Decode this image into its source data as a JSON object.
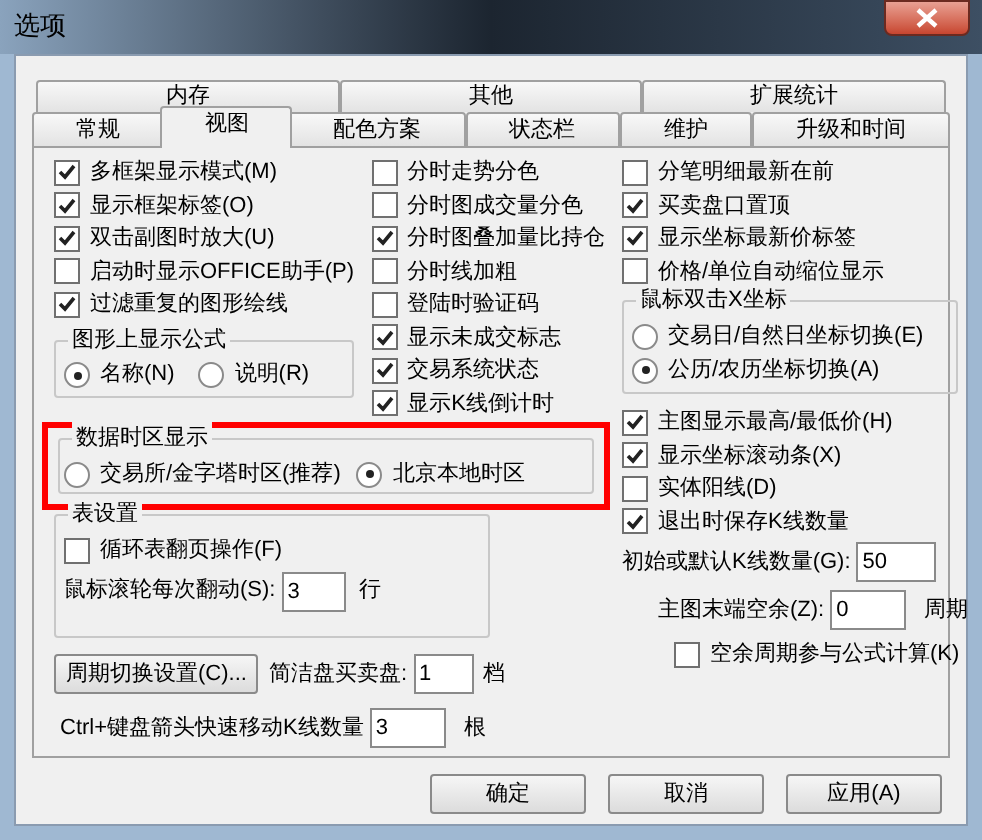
{
  "window": {
    "title": "选项"
  },
  "tabs": {
    "back_row": [
      {
        "label": "内存",
        "selected": false
      },
      {
        "label": "其他",
        "selected": false
      },
      {
        "label": "扩展统计",
        "selected": false
      }
    ],
    "front_row": [
      {
        "label": "常规",
        "selected": false
      },
      {
        "label": "视图",
        "selected": true
      },
      {
        "label": "配色方案",
        "selected": false
      },
      {
        "label": "状态栏",
        "selected": false
      },
      {
        "label": "维护",
        "selected": false
      },
      {
        "label": "升级和时间",
        "selected": false
      }
    ]
  },
  "left_checks": [
    {
      "label": "多框架显示模式(M)",
      "checked": true
    },
    {
      "label": "显示框架标签(O)",
      "checked": true
    },
    {
      "label": "双击副图时放大(U)",
      "checked": true
    },
    {
      "label": "启动时显示OFFICE助手(P)",
      "checked": false
    },
    {
      "label": "过滤重复的图形绘线",
      "checked": true
    }
  ],
  "formula_group": {
    "title": "图形上显示公式",
    "options": [
      {
        "label": "名称(N)",
        "selected": true
      },
      {
        "label": "说明(R)",
        "selected": false
      }
    ]
  },
  "middle_checks": [
    {
      "label": "分时走势分色",
      "checked": false
    },
    {
      "label": "分时图成交量分色",
      "checked": false
    },
    {
      "label": "分时图叠加量比持仓",
      "checked": true
    },
    {
      "label": "分时线加粗",
      "checked": false
    },
    {
      "label": "登陆时验证码",
      "checked": false
    },
    {
      "label": "显示未成交标志",
      "checked": true
    },
    {
      "label": "交易系统状态",
      "checked": true
    },
    {
      "label": "显示K线倒计时",
      "checked": true
    }
  ],
  "timezone_group": {
    "title": "数据时区显示",
    "highlighted": true,
    "options": [
      {
        "label": "交易所/金字塔时区(推荐)",
        "selected": false
      },
      {
        "label": "北京本地时区",
        "selected": true
      }
    ]
  },
  "table_group": {
    "title": "表设置",
    "loop_check": {
      "label": "循环表翻页操作(F)",
      "checked": false
    },
    "scroll": {
      "label": "鼠标滚轮每次翻动(S):",
      "value": "3",
      "unit": "行"
    }
  },
  "period_button": "周期切换设置(C)...",
  "simple_quote": {
    "label": "简洁盘买卖盘:",
    "value": "1",
    "unit": "档"
  },
  "ctrl_move": {
    "label": "Ctrl+键盘箭头快速移动K线数量",
    "value": "3",
    "unit": "根"
  },
  "right_checks_top": [
    {
      "label": "分笔明细最新在前",
      "checked": false
    },
    {
      "label": "买卖盘口置顶",
      "checked": true
    },
    {
      "label": "显示坐标最新价标签",
      "checked": true
    },
    {
      "label": "价格/单位自动缩位显示",
      "checked": false
    }
  ],
  "xaxis_group": {
    "title": "鼠标双击X坐标",
    "options": [
      {
        "label": "交易日/自然日坐标切换(E)",
        "selected": false
      },
      {
        "label": "公历/农历坐标切换(A)",
        "selected": true
      }
    ]
  },
  "right_checks_bottom": [
    {
      "label": "主图显示最高/最低价(H)",
      "checked": true
    },
    {
      "label": "显示坐标滚动条(X)",
      "checked": true
    },
    {
      "label": "实体阳线(D)",
      "checked": false
    },
    {
      "label": "退出时保存K线数量",
      "checked": true
    }
  ],
  "initial_k": {
    "label": "初始或默认K线数量(G):",
    "value": "50"
  },
  "tail_space": {
    "label": "主图末端空余(Z):",
    "value": "0",
    "unit": "周期"
  },
  "space_check": {
    "label": "空余周期参与公式计算(K)",
    "checked": false
  },
  "buttons": [
    "确定",
    "取消",
    "应用(A)"
  ]
}
